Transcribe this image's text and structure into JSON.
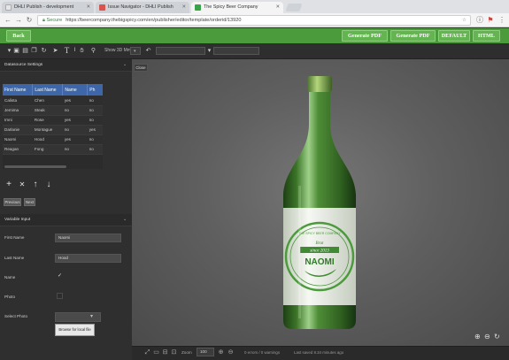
{
  "browser": {
    "tabs": [
      {
        "title": "DHLI Publish - development",
        "favicon_color": "#e6e6e6"
      },
      {
        "title": "Issue Navigator - DHLI Publish",
        "favicon_color": "#d9534f"
      },
      {
        "title": "The Spicy Beer Company",
        "favicon_color": "#3aa34a"
      }
    ],
    "secure_label": "Secure",
    "url": "https://beercompany.thebigspicy.com/en/publisher/editor/template/orderid/13920"
  },
  "appbar": {
    "back_label": "Back",
    "buttons": [
      "Generate PDF",
      "Generate PDF",
      "DEFAULT",
      "HTML"
    ]
  },
  "toolbar": {
    "icons": [
      "save-icon",
      "save-as-icon",
      "copy-icon",
      "refresh-icon",
      "pointer-icon",
      "text-tool-icon",
      "hand-icon",
      "zoom-icon"
    ],
    "show3d_label": "Show 3D Mm",
    "undo_icon": "undo-icon"
  },
  "left": {
    "datasource_header": "Datasource Settings",
    "close_label": "Close",
    "columns": [
      "First Name",
      "Last Name",
      "Name",
      "Ph"
    ],
    "rows": [
      [
        "Calista",
        "Chen",
        "yes",
        "no"
      ],
      [
        "Jemima",
        "Steak",
        "no",
        "no"
      ],
      [
        "Imni",
        "Rose",
        "yes",
        "no"
      ],
      [
        "Darlanie",
        "Montague",
        "no",
        "yes"
      ],
      [
        "Naomi",
        "Hood",
        "yes",
        "no"
      ],
      [
        "Reagan",
        "Fong",
        "no",
        "no"
      ]
    ],
    "actions": [
      "+",
      "✕",
      "↑",
      "↓"
    ],
    "previous_label": "Previous",
    "next_label": "Next",
    "variable_header": "Variable Input",
    "fields": {
      "first_name_label": "First Name",
      "first_name_value": "Naomi",
      "last_name_label": "Last Name",
      "last_name_value": "Hood",
      "name_label": "Name",
      "photo_label": "Photo",
      "select_photo_label": "Select Photo",
      "browse_label": "Browse for local file"
    }
  },
  "label": {
    "since": "since 2013",
    "brand": "Brut",
    "name": "NAOMI",
    "arc_top": "THE SPICY BEER COMPANY"
  },
  "status": {
    "zoom_label": "Zoom",
    "zoom_value": "100",
    "errors_text": "0 errors / 0 warnings",
    "saved_text": "Last saved 8.34 minutes ago"
  },
  "colors": {
    "accent_green": "#4b9a3c",
    "table_header": "#3d67a8",
    "bottle": "#3f7a2a"
  }
}
